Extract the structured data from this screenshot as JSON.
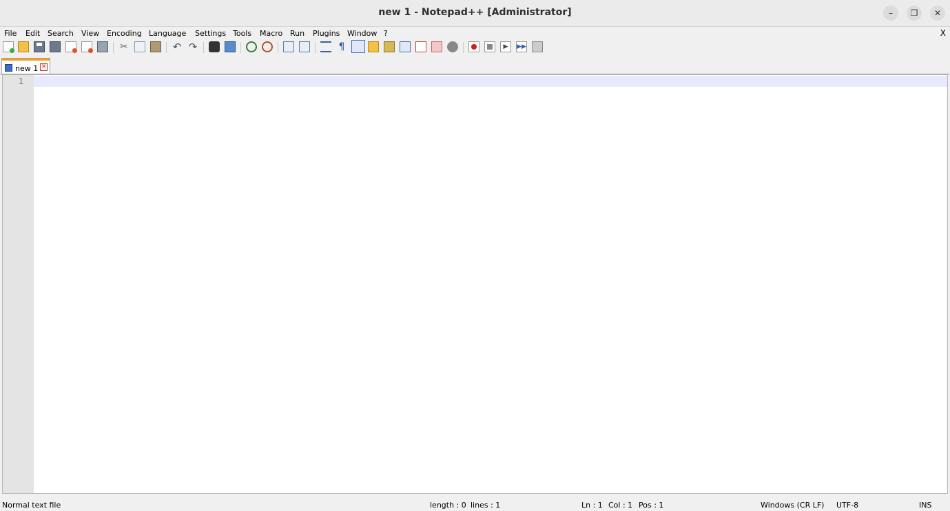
{
  "window": {
    "title": "new 1 - Notepad++ [Administrator]",
    "minimize_glyph": "–",
    "restore_glyph": "❐",
    "close_glyph": "✕"
  },
  "menu": {
    "items": [
      "File",
      "Edit",
      "Search",
      "View",
      "Encoding",
      "Language",
      "Settings",
      "Tools",
      "Macro",
      "Run",
      "Plugins",
      "Window",
      "?"
    ],
    "close_glyph": "X"
  },
  "toolbar": {
    "icons": [
      "new-file",
      "open-file",
      "save",
      "save-all",
      "close",
      "close-all",
      "print",
      "cut",
      "copy",
      "paste",
      "undo",
      "redo",
      "find",
      "replace",
      "zoom-in",
      "zoom-out",
      "sync-vertical",
      "sync-horizontal",
      "word-wrap",
      "show-all-characters",
      "indent-guide",
      "user-defined-language",
      "document-map",
      "function-list",
      "folder-as-workspace",
      "monitoring",
      "record-macro",
      "stop-recording",
      "play-macro",
      "run-macro-multiple",
      "save-macro"
    ]
  },
  "tabs": [
    {
      "label": "new 1",
      "active": true,
      "accent": "#fa9c1b"
    }
  ],
  "editor": {
    "line_numbers": [
      "1"
    ],
    "current_line_color": "#e8e8ff"
  },
  "status": {
    "file_type": "Normal text file",
    "length": "length : 0",
    "lines": "lines : 1",
    "ln": "Ln : 1",
    "col": "Col : 1",
    "pos": "Pos : 1",
    "eol": "Windows (CR LF)",
    "encoding": "UTF-8",
    "mode": "INS"
  }
}
